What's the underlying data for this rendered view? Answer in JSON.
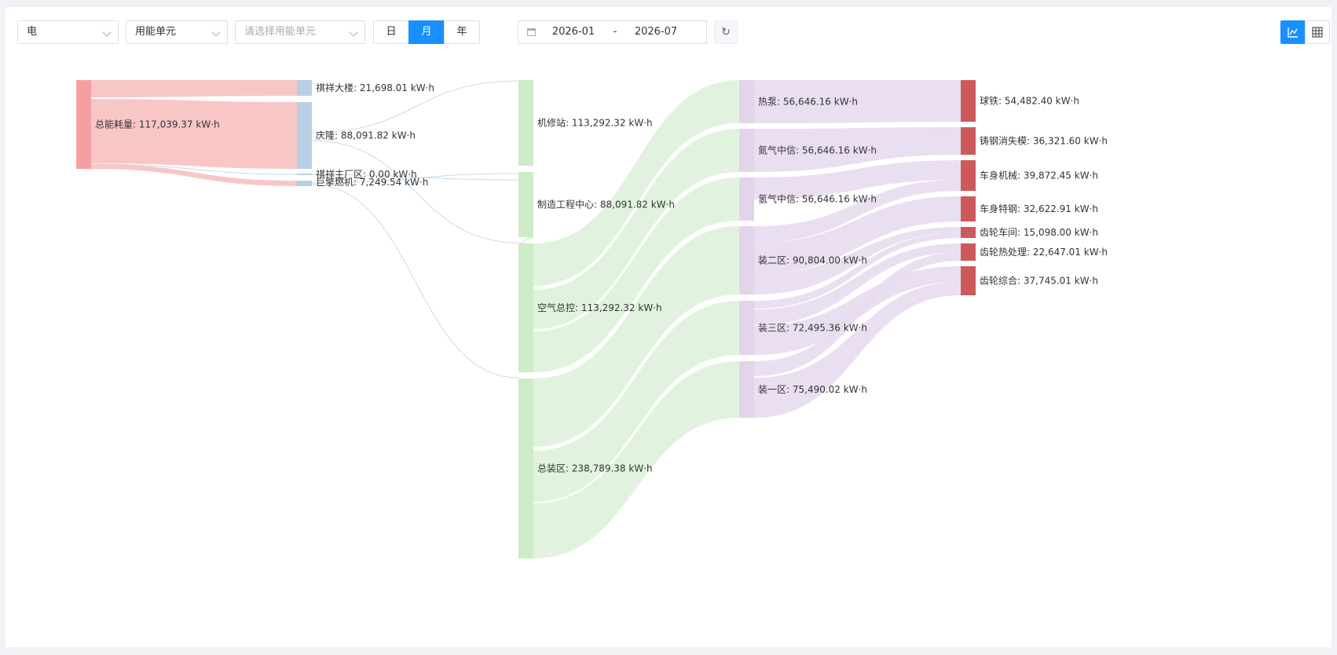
{
  "toolbar": {
    "energy_type": "电",
    "dimension": "用能单元",
    "unit_placeholder": "请选择用能单元",
    "granularity": [
      {
        "label": "日",
        "active": false
      },
      {
        "label": "月",
        "active": true
      },
      {
        "label": "年",
        "active": false
      }
    ],
    "date_start": "2026-01",
    "date_separator": "-",
    "date_end": "2026-07",
    "icons": {
      "refresh": "refresh-icon",
      "calendar": "calendar-icon",
      "chart_view": "chart-icon",
      "table_view": "table-icon"
    },
    "active_view": "chart"
  },
  "chart_data": {
    "type": "sankey",
    "unit": "kW·h",
    "colors": {
      "level0": "#f4a0a0",
      "level0_link": "#f8bcbc",
      "level1": "#b8cfe4",
      "level2": "#cdebc7",
      "level2_link": "#def2da",
      "level3": "#e3d4ea",
      "level3_link": "#e8dcef",
      "level4": "#cd5a5a"
    },
    "nodes": [
      {
        "id": "total",
        "name": "总能耗量",
        "value": "117,039.37",
        "level": 0
      },
      {
        "id": "qixiang",
        "name": "祺祥大楼",
        "value": "21,698.01",
        "level": 1
      },
      {
        "id": "qinglong",
        "name": "庆隆",
        "value": "88,091.82",
        "level": 1
      },
      {
        "id": "qixiangmain",
        "name": "祺祥主厂区",
        "value": "0.00",
        "level": 1
      },
      {
        "id": "juqing",
        "name": "巨擎燃机",
        "value": "7,249.54",
        "level": 1
      },
      {
        "id": "jixiu",
        "name": "机修站",
        "value": "113,292.32",
        "level": 2
      },
      {
        "id": "zhizao",
        "name": "制造工程中心",
        "value": "88,091.82",
        "level": 2
      },
      {
        "id": "kongqi",
        "name": "空气总控",
        "value": "113,292.32",
        "level": 2
      },
      {
        "id": "zongzhuang",
        "name": "总装区",
        "value": "238,789.38",
        "level": 2
      },
      {
        "id": "rebeng",
        "name": "热泵",
        "value": "56,646.16",
        "level": 3
      },
      {
        "id": "danqi",
        "name": "氮气中信",
        "value": "56,646.16",
        "level": 3
      },
      {
        "id": "qingqi",
        "name": "氢气中信",
        "value": "56,646.16",
        "level": 3
      },
      {
        "id": "zhuang2",
        "name": "装二区",
        "value": "90,804.00",
        "level": 3
      },
      {
        "id": "zhuang3",
        "name": "装三区",
        "value": "72,495.36",
        "level": 3
      },
      {
        "id": "zhuang1",
        "name": "装一区",
        "value": "75,490.02",
        "level": 3
      },
      {
        "id": "qiutie",
        "name": "球铁",
        "value": "54,482.40",
        "level": 4
      },
      {
        "id": "zhugang",
        "name": "铸钢消失模",
        "value": "36,321.60",
        "level": 4
      },
      {
        "id": "cheshenjx",
        "name": "车身机械",
        "value": "39,872.45",
        "level": 4
      },
      {
        "id": "cheshentg",
        "name": "车身特钢",
        "value": "32,622.91",
        "level": 4
      },
      {
        "id": "chilunchejian",
        "name": "齿轮车间",
        "value": "15,098.00",
        "level": 4
      },
      {
        "id": "chilunrechuli",
        "name": "齿轮热处理",
        "value": "22,647.01",
        "level": 4
      },
      {
        "id": "chilunzonghe",
        "name": "齿轮综合",
        "value": "37,745.01",
        "level": 4
      }
    ],
    "links": [
      {
        "source": "total",
        "target": "qixiang"
      },
      {
        "source": "total",
        "target": "qinglong"
      },
      {
        "source": "total",
        "target": "qixiangmain"
      },
      {
        "source": "total",
        "target": "juqing"
      },
      {
        "source": "qinglong",
        "target": "jixiu"
      },
      {
        "source": "qinglong",
        "target": "zhizao"
      },
      {
        "source": "juqing",
        "target": "zhizao"
      },
      {
        "source": "juqing",
        "target": "kongqi"
      },
      {
        "source": "qixiangmain",
        "target": "zhizao"
      },
      {
        "source": "zhizao",
        "target": "kongqi"
      },
      {
        "source": "kongqi",
        "target": "rebeng"
      },
      {
        "source": "kongqi",
        "target": "danqi"
      },
      {
        "source": "kongqi",
        "target": "qingqi"
      },
      {
        "source": "zongzhuang",
        "target": "zhuang2"
      },
      {
        "source": "zongzhuang",
        "target": "zhuang3"
      },
      {
        "source": "zongzhuang",
        "target": "zhuang1"
      },
      {
        "source": "rebeng",
        "target": "qiutie"
      },
      {
        "source": "danqi",
        "target": "zhugang"
      },
      {
        "source": "qingqi",
        "target": "cheshenjx"
      },
      {
        "source": "zhuang2",
        "target": "cheshenjx"
      },
      {
        "source": "zhuang2",
        "target": "cheshentg"
      },
      {
        "source": "zhuang2",
        "target": "chilunchejian"
      },
      {
        "source": "zhuang3",
        "target": "chilunchejian"
      },
      {
        "source": "zhuang3",
        "target": "chilunrechuli"
      },
      {
        "source": "zhuang3",
        "target": "chilunzonghe"
      },
      {
        "source": "zhuang1",
        "target": "chilunrechuli"
      },
      {
        "source": "zhuang1",
        "target": "chilunzonghe"
      }
    ]
  }
}
